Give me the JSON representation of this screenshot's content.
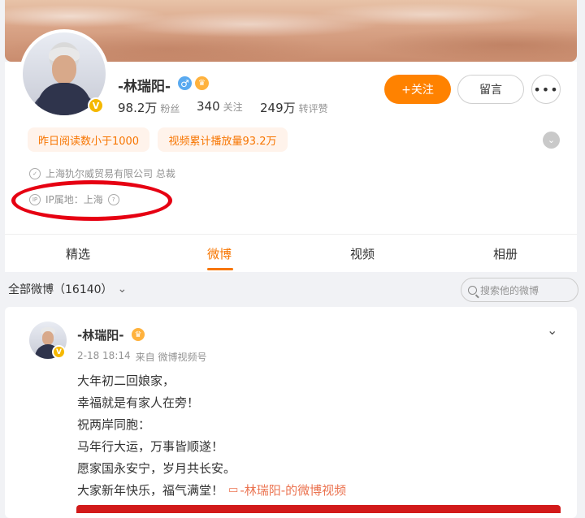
{
  "profile": {
    "name": "-林瑞阳-",
    "gender_symbol": "♂",
    "verified_badge": "V",
    "stats": [
      {
        "num": "98.2万",
        "label": "粉丝"
      },
      {
        "num": "340",
        "label": "关注"
      },
      {
        "num": "249万",
        "label": "转评赞"
      }
    ],
    "actions": {
      "follow": "+关注",
      "message": "留言",
      "more": "•••"
    },
    "chips": [
      "昨日阅读数小于1000",
      "视频累计播放量93.2万"
    ],
    "company": "上海犰尔威贸易有限公司 总裁",
    "ip": "IP属地：上海"
  },
  "tabs": [
    "精选",
    "微博",
    "视频",
    "相册"
  ],
  "active_tab": "微博",
  "filter": {
    "label": "全部微博（16140）",
    "chevron": "⌄"
  },
  "search": {
    "placeholder": "搜索他的微博"
  },
  "post": {
    "author": "-林瑞阳-",
    "time": "2-18 18:14",
    "source": "来自 微博视频号",
    "lines": [
      "大年初二回娘家，",
      "幸福就是有家人在旁！",
      "祝两岸同胞：",
      "马年行大运，万事皆顺遂！",
      "愿家国永安宁，岁月共长安。",
      "大家新年快乐，福气满堂！"
    ],
    "video_link": "-林瑞阳-的微博视频"
  },
  "colors": {
    "accent": "#ff8200",
    "link": "#eb7350",
    "highlight_circle": "#e60012"
  }
}
